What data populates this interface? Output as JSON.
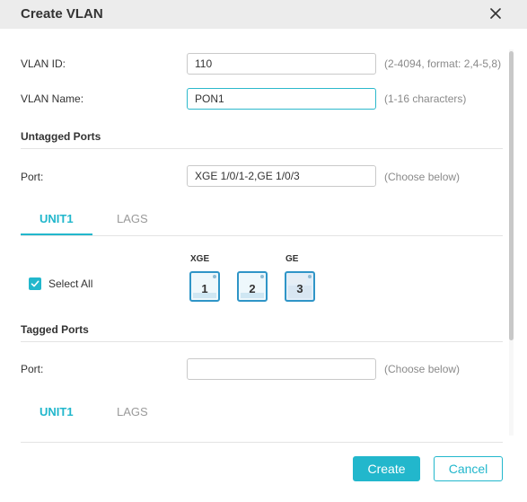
{
  "dialog": {
    "title": "Create VLAN"
  },
  "vlan_id": {
    "label": "VLAN ID:",
    "value": "110",
    "hint": "(2-4094, format: 2,4-5,8)"
  },
  "vlan_name": {
    "label": "VLAN Name:",
    "value": "PON1",
    "hint": "(1-16 characters)"
  },
  "untagged": {
    "heading": "Untagged Ports",
    "port_label": "Port:",
    "port_value": "XGE 1/0/1-2,GE 1/0/3",
    "hint": "(Choose below)",
    "tabs": [
      "UNIT1",
      "LAGS"
    ],
    "active_tab": "UNIT1",
    "select_all_label": "Select All",
    "select_all_checked": true,
    "groups": [
      {
        "label": "XGE",
        "ports": [
          {
            "number": "1",
            "selected": true
          },
          {
            "number": "2",
            "selected": true
          }
        ]
      },
      {
        "label": "GE",
        "ports": [
          {
            "number": "3",
            "selected": true
          }
        ]
      }
    ]
  },
  "tagged": {
    "heading": "Tagged Ports",
    "port_label": "Port:",
    "port_value": "",
    "hint": "(Choose below)",
    "tabs": [
      "UNIT1",
      "LAGS"
    ],
    "active_tab": "UNIT1"
  },
  "footer": {
    "create_label": "Create",
    "cancel_label": "Cancel"
  },
  "colors": {
    "accent": "#22b7cc",
    "port_border": "#2f95c7",
    "header_bg": "#ececec"
  }
}
